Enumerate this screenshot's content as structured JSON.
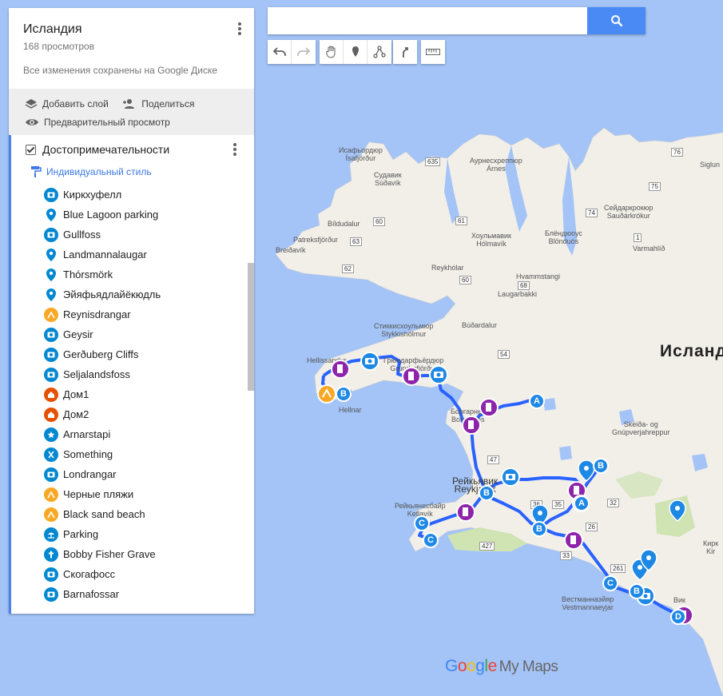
{
  "map": {
    "country_label": "Исланд",
    "logo": {
      "g1": "G",
      "o1": "o",
      "o2": "o",
      "g2": "g",
      "l": "l",
      "e": "e",
      "suffix": "My Maps"
    },
    "places": [
      {
        "id": "isafj",
        "text": "Исафьордюр\nÍsafjörður"
      },
      {
        "id": "sudav",
        "text": "Судавик\nSúðavík"
      },
      {
        "id": "aurnes",
        "text": "Аурнесхреппюр\nÁrnes"
      },
      {
        "id": "bild",
        "text": "Bíldudalur"
      },
      {
        "id": "patr",
        "text": "Patreksfjörður"
      },
      {
        "id": "breid",
        "text": "Breiðavík"
      },
      {
        "id": "holm",
        "text": "Хоульмавик\nHólmavík"
      },
      {
        "id": "reyk",
        "text": "Reykhólar"
      },
      {
        "id": "hvam",
        "text": "Hvammstangi"
      },
      {
        "id": "laug",
        "text": "Laugarbakki"
      },
      {
        "id": "stykk",
        "text": "Стиккисхоульмюр\nStykkishólmur"
      },
      {
        "id": "budar",
        "text": "Búðardalur"
      },
      {
        "id": "grund",
        "text": "Грюндарфьёрдюр\nGrundarfjörður"
      },
      {
        "id": "hell",
        "text": "Hellissandur"
      },
      {
        "id": "hellnar",
        "text": "Hellnar"
      },
      {
        "id": "borg",
        "text": "Боргарнес\nBorgarnes"
      },
      {
        "id": "reykv",
        "text": "Рейкьявик\nReykjavík"
      },
      {
        "id": "reykn",
        "text": "Рейкьянесбайр\nKeflavík"
      },
      {
        "id": "skeid",
        "text": "Skeiða- og\nGnúpverjahreppur"
      },
      {
        "id": "vest",
        "text": "Вестманнаэйяр\nVestmannaeyjar"
      },
      {
        "id": "vik",
        "text": "Вик"
      },
      {
        "id": "seyd",
        "text": "Сейдаркрокюр\nSauðárkrókur"
      },
      {
        "id": "blond",
        "text": "Блёндюоус\nBlönduós"
      },
      {
        "id": "varm",
        "text": "Varmahlíð"
      },
      {
        "id": "siglu",
        "text": "Siglun"
      },
      {
        "id": "kirk",
        "text": "Кирк\nKir"
      }
    ],
    "roads": [
      "635",
      "60",
      "61",
      "63",
      "62",
      "68",
      "60",
      "54",
      "74",
      "76",
      "75",
      "1",
      "47",
      "36",
      "35",
      "26",
      "32",
      "427",
      "261",
      "33"
    ],
    "markers": {
      "a": "A",
      "b": "B",
      "c": "C",
      "d": "D"
    }
  },
  "panel": {
    "title": "Исландия",
    "views": "168 просмотров",
    "saved": "Все изменения сохранены на Google Диске",
    "add_layer": "Добавить слой",
    "share": "Поделиться",
    "preview": "Предварительный просмотр",
    "layer": {
      "name": "Достопримечательности",
      "style": "Индивидуальный стиль",
      "items": [
        {
          "label": "Киркхуфелл",
          "icon": "camera-icon",
          "color": "#0288d1"
        },
        {
          "label": "Blue Lagoon parking",
          "icon": "pin-icon",
          "color": "#0288d1"
        },
        {
          "label": "Gullfoss",
          "icon": "camera-icon",
          "color": "#0288d1"
        },
        {
          "label": "Landmannalaugar",
          "icon": "pin-icon",
          "color": "#0288d1"
        },
        {
          "label": "Thórsmörk",
          "icon": "pin-icon",
          "color": "#0288d1"
        },
        {
          "label": "Эйяфьядлайёкюдль",
          "icon": "pin-icon",
          "color": "#0288d1"
        },
        {
          "label": "Reynisdrangar",
          "icon": "hiking-icon",
          "color": "#f9a825"
        },
        {
          "label": "Geysir",
          "icon": "camera-icon",
          "color": "#0288d1"
        },
        {
          "label": "Gerðuberg Cliffs",
          "icon": "camera-icon",
          "color": "#0288d1"
        },
        {
          "label": "Seljalandsfoss",
          "icon": "camera-icon",
          "color": "#0288d1"
        },
        {
          "label": "Дом1",
          "icon": "home-icon",
          "color": "#e65100"
        },
        {
          "label": "Дом2",
          "icon": "home-icon",
          "color": "#e65100"
        },
        {
          "label": "Arnarstapi",
          "icon": "star-icon",
          "color": "#0288d1"
        },
        {
          "label": "Something",
          "icon": "utensils-icon",
          "color": "#0288d1"
        },
        {
          "label": "Londrangar",
          "icon": "camera-icon",
          "color": "#0288d1"
        },
        {
          "label": "Черные пляжи",
          "icon": "hiking-icon",
          "color": "#f9a825"
        },
        {
          "label": "Black sand beach",
          "icon": "hiking-icon",
          "color": "#f9a825"
        },
        {
          "label": "Parking",
          "icon": "beach-icon",
          "color": "#0288d1"
        },
        {
          "label": "Bobby Fisher Grave",
          "icon": "cross-icon",
          "color": "#0288d1"
        },
        {
          "label": "Скогафосс",
          "icon": "camera-icon",
          "color": "#0288d1"
        },
        {
          "label": "Barnafossar",
          "icon": "camera-icon",
          "color": "#0288d1"
        }
      ]
    }
  },
  "search": {
    "placeholder": ""
  },
  "colors": {
    "route": "#2962ff",
    "marker_blue": "#1e88e5",
    "fuel": "#8e24aa",
    "land": "#f2efe9",
    "water": "#a4c4f7"
  }
}
